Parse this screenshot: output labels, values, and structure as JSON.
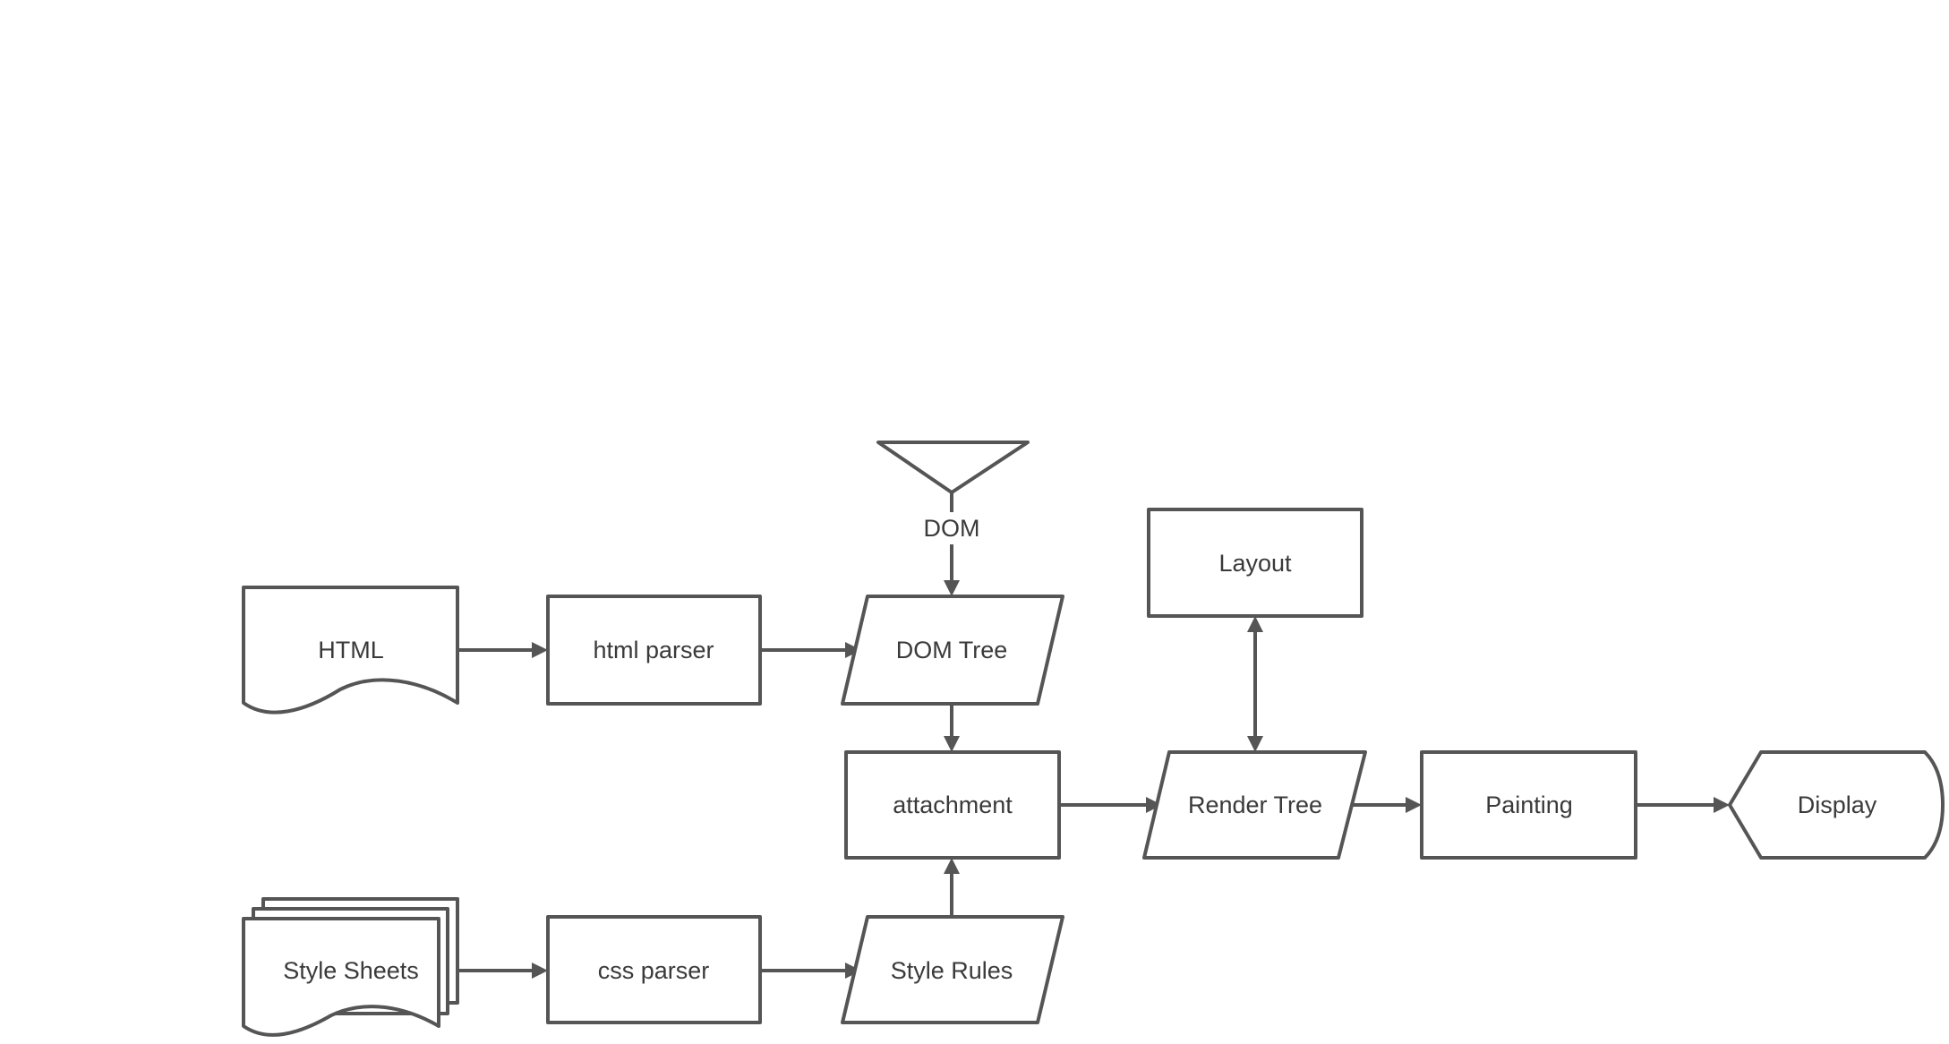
{
  "diagram": {
    "colors": {
      "stroke": "#555555",
      "text": "#3a3a3a",
      "background": "#ffffff"
    },
    "nodes": {
      "html": {
        "label": "HTML",
        "shape": "document"
      },
      "html_parser": {
        "label": "html parser",
        "shape": "process"
      },
      "dom_source": {
        "label": "DOM",
        "shape": "merge-triangle"
      },
      "dom_tree": {
        "label": "DOM Tree",
        "shape": "data-parallelogram"
      },
      "style_sheets": {
        "label": "Style Sheets",
        "shape": "multi-document"
      },
      "css_parser": {
        "label": "css parser",
        "shape": "process"
      },
      "style_rules": {
        "label": "Style Rules",
        "shape": "data-parallelogram"
      },
      "attachment": {
        "label": "attachment",
        "shape": "process"
      },
      "layout": {
        "label": "Layout",
        "shape": "process"
      },
      "render_tree": {
        "label": "Render Tree",
        "shape": "data-parallelogram"
      },
      "painting": {
        "label": "Painting",
        "shape": "process"
      },
      "display": {
        "label": "Display",
        "shape": "display"
      }
    },
    "edges": [
      {
        "from": "html",
        "to": "html_parser"
      },
      {
        "from": "html_parser",
        "to": "dom_tree"
      },
      {
        "from": "dom_source",
        "to": "dom_tree"
      },
      {
        "from": "dom_tree",
        "to": "attachment"
      },
      {
        "from": "style_sheets",
        "to": "css_parser"
      },
      {
        "from": "css_parser",
        "to": "style_rules"
      },
      {
        "from": "style_rules",
        "to": "attachment"
      },
      {
        "from": "attachment",
        "to": "render_tree"
      },
      {
        "from": "render_tree",
        "to": "layout",
        "bidirectional": true
      },
      {
        "from": "render_tree",
        "to": "painting"
      },
      {
        "from": "painting",
        "to": "display"
      }
    ]
  }
}
